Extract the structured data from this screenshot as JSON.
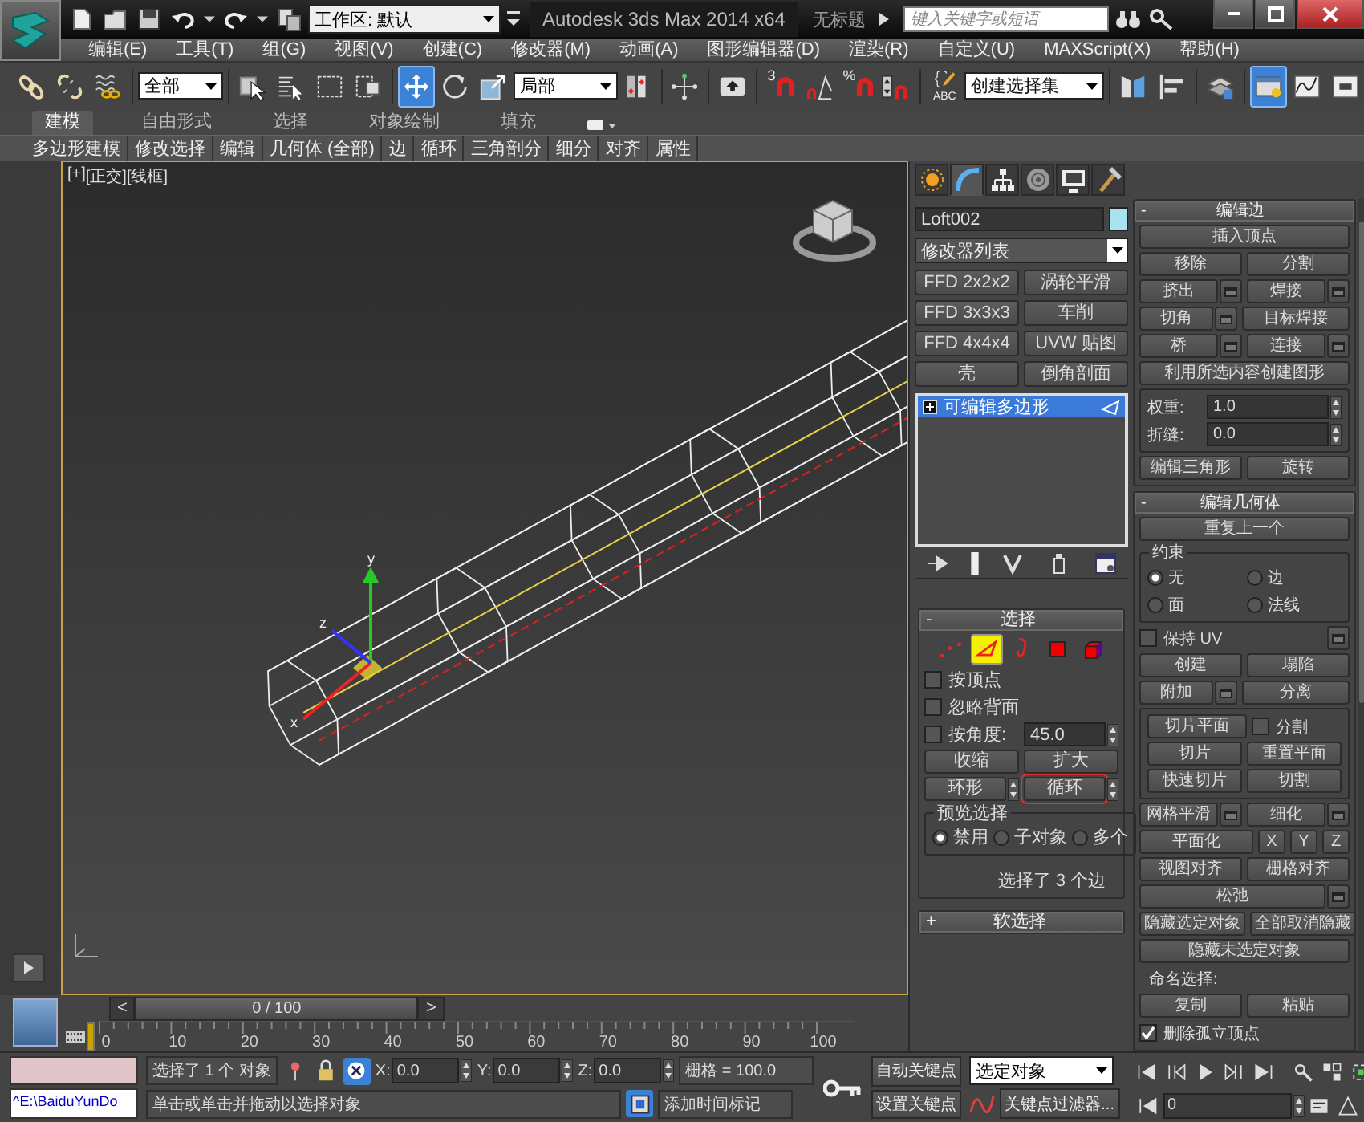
{
  "title_bar": {
    "workspace": "工作区: 默认",
    "app_title": "Autodesk 3ds Max  2014 x64",
    "document": "无标题",
    "search": {
      "placeholder": "键入关键字或短语"
    }
  },
  "menu": [
    "编辑(E)",
    "工具(T)",
    "组(G)",
    "视图(V)",
    "创建(C)",
    "修改器(M)",
    "动画(A)",
    "图形编辑器(D)",
    "渲染(R)",
    "自定义(U)",
    "MAXScript(X)",
    "帮助(H)"
  ],
  "main_toolbar": {
    "selection_filter": "全部",
    "reference_coords": "局部",
    "named_selection_set": "创建选择集",
    "tools": [
      {
        "selected": false
      },
      {
        "selected": false
      },
      {
        "selected": false
      },
      {
        "selected": false
      },
      {
        "selected": false
      },
      {
        "selected": false
      },
      {
        "selected": false
      },
      {
        "selected": true
      },
      {
        "selected": false
      },
      {
        "selected": false
      },
      {
        "selected": false
      },
      {
        "selected": false
      },
      {
        "selected": false
      },
      {
        "selected": false,
        "text": "3"
      },
      {
        "selected": false
      },
      {
        "selected": false,
        "text": "%"
      },
      {
        "selected": false
      },
      {
        "selected": false,
        "text": "ABC"
      },
      {
        "selected": false
      },
      {
        "selected": false
      },
      {
        "selected": false
      },
      {
        "selected": true
      },
      {
        "selected": false
      },
      {
        "selected": false
      }
    ]
  },
  "ribbon": {
    "tabs": [
      {
        "label": "建模",
        "selected": true
      },
      {
        "label": "自由形式",
        "selected": false
      },
      {
        "label": "选择",
        "selected": false
      },
      {
        "label": "对象绘制",
        "selected": false
      },
      {
        "label": "填充",
        "selected": false
      }
    ],
    "panels": [
      "多边形建模",
      "修改选择",
      "编辑",
      "几何体 (全部)",
      "边",
      "循环",
      "三角剖分",
      "细分",
      "对齐",
      "属性"
    ]
  },
  "viewport": {
    "labels": [
      "[+]",
      "[正交]",
      "[线框]"
    ],
    "gizmo_axes": [
      "x",
      "y",
      "z"
    ]
  },
  "timeline": {
    "prev": "<",
    "position": "0 / 100",
    "next": ">",
    "ticks": [
      "0",
      "10",
      "20",
      "30",
      "40",
      "50",
      "60",
      "70",
      "80",
      "90",
      "100"
    ]
  },
  "command_panel": {
    "tabs": [
      {
        "selected": false
      },
      {
        "selected": true
      },
      {
        "selected": false
      },
      {
        "selected": false
      },
      {
        "selected": false
      },
      {
        "selected": false
      }
    ],
    "object_name": "Loft002",
    "modifier_list": "修改器列表",
    "modifier_buttons": [
      "FFD 2x2x2",
      "涡轮平滑",
      "FFD 3x3x3",
      "车削",
      "FFD 4x4x4",
      "UVW 贴图",
      "壳",
      "倒角剖面"
    ],
    "stack": [
      {
        "label": "可编辑多边形",
        "selected": true
      }
    ],
    "rollouts": [
      {
        "toggle": "-",
        "title": "选择",
        "rows": [
          [
            {
              "kind": "subobjects",
              "items": [
                {
                  "selected": false
                },
                {
                  "selected": true
                },
                {
                  "selected": false
                },
                {
                  "selected": false
                },
                {
                  "selected": false
                }
              ]
            }
          ],
          [
            {
              "kind": "checkbox",
              "label": "按顶点",
              "checked": false
            }
          ],
          [
            {
              "kind": "checkbox",
              "label": "忽略背面",
              "checked": false
            }
          ],
          [
            {
              "kind": "checkbox",
              "label": "按角度:",
              "checked": false
            },
            {
              "kind": "spinner",
              "value": "45.0"
            }
          ],
          [
            {
              "kind": "button",
              "label": "收缩"
            },
            {
              "kind": "button",
              "label": "扩大"
            }
          ],
          [
            {
              "kind": "spin_button",
              "label": "环形",
              "outlined": false
            },
            {
              "kind": "spin_button",
              "label": "循环",
              "outlined": true
            }
          ],
          [
            {
              "kind": "group",
              "title": "预览选择",
              "rows": [
                [
                  {
                    "kind": "radio",
                    "label": "禁用",
                    "selected": true
                  },
                  {
                    "kind": "radio",
                    "label": "子对象",
                    "selected": false
                  },
                  {
                    "kind": "radio",
                    "label": "多个",
                    "selected": false
                  }
                ]
              ]
            }
          ],
          [
            {
              "kind": "status",
              "text": "选择了 3 个边"
            }
          ]
        ]
      },
      {
        "toggle": "+",
        "title": "软选择"
      }
    ]
  },
  "edit_rollouts": [
    {
      "toggle": "-",
      "title": "编辑边",
      "rows": [
        [
          {
            "kind": "button",
            "label": "插入顶点"
          }
        ],
        [
          {
            "kind": "button",
            "label": "移除"
          },
          {
            "kind": "button",
            "label": "分割"
          }
        ],
        [
          {
            "kind": "option_button",
            "label": "挤出"
          },
          {
            "kind": "option_button",
            "label": "焊接"
          }
        ],
        [
          {
            "kind": "option_button",
            "label": "切角"
          },
          {
            "kind": "button",
            "label": "目标焊接"
          }
        ],
        [
          {
            "kind": "option_button",
            "label": "桥"
          },
          {
            "kind": "option_button",
            "label": "连接"
          }
        ],
        [
          {
            "kind": "button",
            "label": "利用所选内容创建图形"
          }
        ],
        [
          {
            "kind": "group",
            "rows": [
              [
                {
                  "kind": "spinner",
                  "label": "权重:",
                  "value": "1.0"
                }
              ],
              [
                {
                  "kind": "spinner",
                  "label": "折缝:",
                  "value": "0.0"
                }
              ]
            ]
          }
        ],
        [
          {
            "kind": "button",
            "label": "编辑三角形"
          },
          {
            "kind": "button",
            "label": "旋转"
          }
        ]
      ]
    },
    {
      "toggle": "-",
      "title": "编辑几何体",
      "rows": [
        [
          {
            "kind": "button",
            "label": "重复上一个"
          }
        ],
        [
          {
            "kind": "group",
            "title": "约束",
            "rows": [
              [
                {
                  "kind": "radio",
                  "label": "无",
                  "selected": true
                },
                {
                  "kind": "radio",
                  "label": "边",
                  "selected": false
                }
              ],
              [
                {
                  "kind": "radio",
                  "label": "面",
                  "selected": false
                },
                {
                  "kind": "radio",
                  "label": "法线",
                  "selected": false
                }
              ]
            ]
          }
        ],
        [
          {
            "kind": "checkbox",
            "label": "保持 UV",
            "checked": false
          },
          {
            "kind": "settings"
          }
        ],
        [
          {
            "kind": "button",
            "label": "创建"
          },
          {
            "kind": "button",
            "label": "塌陷"
          }
        ],
        [
          {
            "kind": "option_button",
            "label": "附加"
          },
          {
            "kind": "button",
            "label": "分离"
          }
        ],
        [
          {
            "kind": "group",
            "rows": [
              [
                {
                  "kind": "button",
                  "label": "切片平面"
                },
                {
                  "kind": "checkbox",
                  "label": "分割",
                  "checked": false
                }
              ],
              [
                {
                  "kind": "button",
                  "label": "切片"
                },
                {
                  "kind": "button",
                  "label": "重置平面"
                }
              ],
              [
                {
                  "kind": "button",
                  "label": "快速切片"
                },
                {
                  "kind": "button",
                  "label": "切割"
                }
              ]
            ]
          }
        ],
        [
          {
            "kind": "option_button",
            "label": "网格平滑"
          },
          {
            "kind": "option_button",
            "label": "细化"
          }
        ],
        [
          {
            "kind": "button",
            "label": "平面化"
          },
          {
            "kind": "small_button",
            "label": "X"
          },
          {
            "kind": "small_button",
            "label": "Y"
          },
          {
            "kind": "small_button",
            "label": "Z"
          }
        ],
        [
          {
            "kind": "button",
            "label": "视图对齐"
          },
          {
            "kind": "button",
            "label": "栅格对齐"
          }
        ],
        [
          {
            "kind": "option_button",
            "label": "松弛"
          }
        ],
        [
          {
            "kind": "button",
            "label": "隐藏选定对象"
          },
          {
            "kind": "button",
            "label": "全部取消隐藏"
          }
        ],
        [
          {
            "kind": "button",
            "label": "隐藏未选定对象"
          }
        ],
        [
          {
            "kind": "label",
            "text": "命名选择:"
          }
        ],
        [
          {
            "kind": "button",
            "label": "复制"
          },
          {
            "kind": "button",
            "label": "粘贴"
          }
        ],
        [
          {
            "kind": "checkbox",
            "label": "删除孤立顶点",
            "checked": true
          }
        ]
      ]
    }
  ],
  "status_bar": {
    "listener": "^E:\\BaiduYunDo",
    "selection": "选择了 1 个 对象",
    "coords": [
      {
        "axis": "X:",
        "value": "0.0"
      },
      {
        "axis": "Y:",
        "value": "0.0"
      },
      {
        "axis": "Z:",
        "value": "0.0"
      }
    ],
    "grid": "栅格 = 100.0",
    "prompt": "单击或单击并拖动以选择对象",
    "add_time_tag": "添加时间标记",
    "auto_key": "自动关键点",
    "set_key": "设置关键点",
    "key_mode": "选定对象",
    "key_filters": "关键点过滤器...",
    "frame": "0"
  }
}
